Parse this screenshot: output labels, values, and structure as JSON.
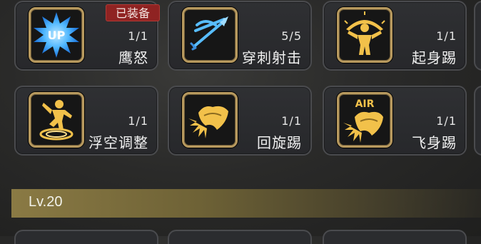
{
  "skills": [
    {
      "name": "鹰怒",
      "count": "1/1",
      "icon": "up-burst-icon",
      "icon_text": "UP",
      "equipped": true
    },
    {
      "name": "穿刺射击",
      "count": "5/5",
      "icon": "bow-arrow-icon"
    },
    {
      "name": "起身踢",
      "count": "1/1",
      "icon": "rising-figure-icon"
    },
    {
      "name": "浮空调整",
      "count": "1/1",
      "icon": "spinning-figure-icon"
    },
    {
      "name": "回旋踢",
      "count": "1/1",
      "icon": "spin-kick-icon"
    },
    {
      "name": "飞身踢",
      "count": "1/1",
      "icon": "air-kick-icon",
      "icon_text": "AIR"
    }
  ],
  "equipped_badge": "已装备",
  "level_label": "Lv.20",
  "colors": {
    "icon_gold": "#f2c14a",
    "icon_blue": "#4fb7ff",
    "badge_red": "#8f2322",
    "frame_gold": "#b89a5f"
  }
}
